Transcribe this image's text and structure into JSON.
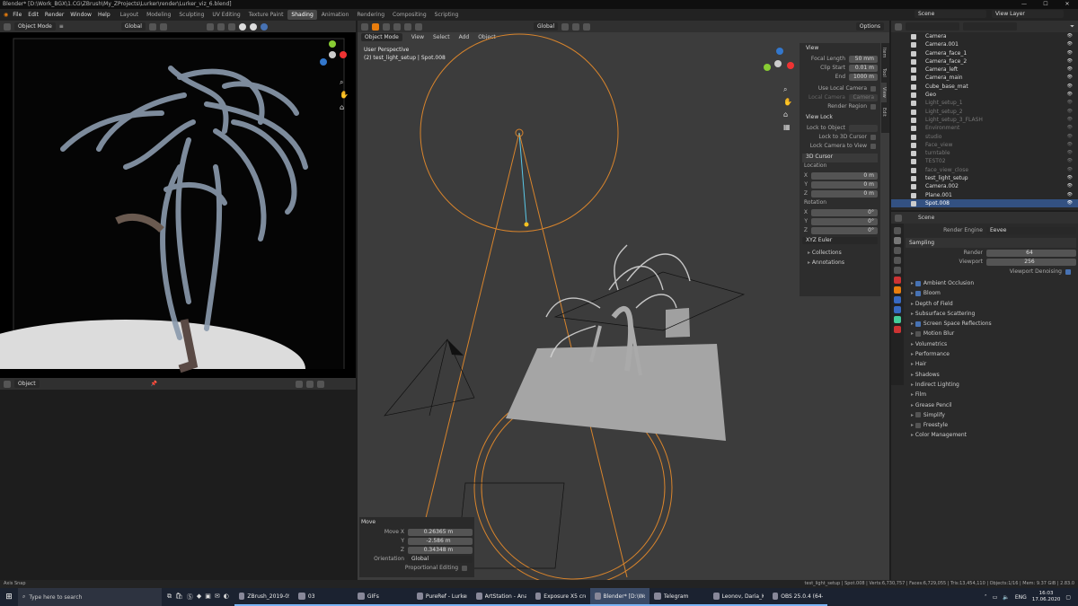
{
  "titlebar": {
    "title": "Blender* [D:\\Work_BGX\\1.CG\\ZBrush\\My_ZProjects\\Lurker\\render\\Lurker_viz_6.blend]"
  },
  "menubar": {
    "menus": [
      "File",
      "Edit",
      "Render",
      "Window",
      "Help"
    ],
    "workspaces": [
      "Layout",
      "Modeling",
      "Sculpting",
      "UV Editing",
      "Texture Paint",
      "Shading",
      "Animation",
      "Rendering",
      "Compositing",
      "Scripting"
    ],
    "active_workspace": "Shading",
    "scene": "Scene",
    "view_layer": "View Layer"
  },
  "left_viewport": {
    "mode": "Object Mode",
    "orientation": "Global"
  },
  "shader_editor": {
    "mode": "Object"
  },
  "main_viewport": {
    "mode": "Object Mode",
    "menus": [
      "View",
      "Select",
      "Add",
      "Object"
    ],
    "orientation": "Global",
    "options": "Options",
    "overlay_title": "User Perspective",
    "overlay_sub": "(2) test_light_setup | Spot.008"
  },
  "npanel": {
    "tabs": [
      "Item",
      "Tool",
      "View",
      "Edit"
    ],
    "view_header": "View",
    "focal_length_label": "Focal Length",
    "focal_length": "50 mm",
    "clip_start_label": "Clip Start",
    "clip_start": "0.01 m",
    "end_label": "End",
    "end": "1000 m",
    "use_local_camera": "Use Local Camera",
    "local_camera": "Local Camera",
    "local_camera_val": "Camera",
    "render_region": "Render Region",
    "view_lock": "View Lock",
    "lock_to_object": "Lock to Object",
    "lock_to_3d_cursor": "Lock to 3D Cursor",
    "lock_camera_to_view": "Lock Camera to View",
    "cursor_header": "3D Cursor",
    "location": "Location",
    "x": "X",
    "y": "Y",
    "z": "Z",
    "loc_x": "0 m",
    "loc_y": "0 m",
    "loc_z": "0 m",
    "rotation": "Rotation",
    "rot_x": "0°",
    "rot_y": "0°",
    "rot_z": "0°",
    "rot_mode": "XYZ Euler",
    "collections": "Collections",
    "annotations": "Annotations"
  },
  "move_panel": {
    "title": "Move",
    "move_x_label": "Move X",
    "move_x": "0.26365 m",
    "y_label": "Y",
    "y": "-2.586 m",
    "z_label": "Z",
    "z": "0.34348 m",
    "orientation_label": "Orientation",
    "orientation": "Global",
    "proportional": "Proportional Editing"
  },
  "outliner": {
    "items": [
      {
        "name": "Camera",
        "dim": false,
        "sel": false
      },
      {
        "name": "Camera.001",
        "dim": false,
        "sel": false
      },
      {
        "name": "Camera_face_1",
        "dim": false,
        "sel": false
      },
      {
        "name": "Camera_face_2",
        "dim": false,
        "sel": false
      },
      {
        "name": "Camera_left",
        "dim": false,
        "sel": false
      },
      {
        "name": "Camera_main",
        "dim": false,
        "sel": false
      },
      {
        "name": "Cube_base_mat",
        "dim": false,
        "sel": false
      },
      {
        "name": "Geo",
        "dim": false,
        "sel": false
      },
      {
        "name": "Light_setup_1",
        "dim": true,
        "sel": false
      },
      {
        "name": "Light_setup_2",
        "dim": true,
        "sel": false
      },
      {
        "name": "Light_setup_3_FLASH",
        "dim": true,
        "sel": false
      },
      {
        "name": "Environment",
        "dim": true,
        "sel": false
      },
      {
        "name": "studio",
        "dim": true,
        "sel": false
      },
      {
        "name": "Face_view",
        "dim": true,
        "sel": false
      },
      {
        "name": "turntable",
        "dim": true,
        "sel": false
      },
      {
        "name": "TEST02",
        "dim": true,
        "sel": false
      },
      {
        "name": "face_view_close",
        "dim": true,
        "sel": false
      },
      {
        "name": "test_light_setup",
        "dim": false,
        "sel": false
      },
      {
        "name": "Camera.002",
        "dim": false,
        "sel": false
      },
      {
        "name": "Plane.001",
        "dim": false,
        "sel": false
      },
      {
        "name": "Spot.008",
        "dim": false,
        "sel": true
      }
    ]
  },
  "properties": {
    "scene": "Scene",
    "render_engine_label": "Render Engine",
    "render_engine": "Eevee",
    "sampling": "Sampling",
    "render_label": "Render",
    "render": "64",
    "viewport_label": "Viewport",
    "viewport": "256",
    "viewport_denoising": "Viewport Denoising",
    "sections": [
      {
        "name": "Ambient Occlusion",
        "check": true
      },
      {
        "name": "Bloom",
        "check": true
      },
      {
        "name": "Depth of Field",
        "check": null
      },
      {
        "name": "Subsurface Scattering",
        "check": null
      },
      {
        "name": "Screen Space Reflections",
        "check": true
      },
      {
        "name": "Motion Blur",
        "check": false
      },
      {
        "name": "Volumetrics",
        "check": null
      },
      {
        "name": "Performance",
        "check": null
      },
      {
        "name": "Hair",
        "check": null
      },
      {
        "name": "Shadows",
        "check": null
      },
      {
        "name": "Indirect Lighting",
        "check": null
      },
      {
        "name": "Film",
        "check": null
      },
      {
        "name": "Grease Pencil",
        "check": null
      },
      {
        "name": "Simplify",
        "check": false
      },
      {
        "name": "Freestyle",
        "check": false
      },
      {
        "name": "Color Management",
        "check": null
      }
    ]
  },
  "statusbar": {
    "left": "Axis Snap",
    "right": "test_light_setup | Spot.008 | Verts:6,730,757 | Faces:6,729,055 | Tris:13,454,110 | Objects:1/16 | Mem: 9.37 GiB | 2.83.0"
  },
  "taskbar": {
    "search": "Type here to search",
    "tasks": [
      {
        "label": "ZBrush_2019-05-...",
        "open": true,
        "active": false
      },
      {
        "label": "03",
        "open": true,
        "active": false
      },
      {
        "label": "GIFs",
        "open": true,
        "active": false
      },
      {
        "label": "PureRef - Lurker...",
        "open": true,
        "active": false
      },
      {
        "label": "ArtStation - Anal...",
        "open": true,
        "active": false
      },
      {
        "label": "Exposure X5 crea...",
        "open": true,
        "active": false
      },
      {
        "label": "Blender* [D:\\Wor...",
        "open": true,
        "active": true
      },
      {
        "label": "Telegram",
        "open": true,
        "active": false
      },
      {
        "label": "Leonov, Daria_Kr...",
        "open": true,
        "active": false
      },
      {
        "label": "OBS 25.0.4 (64-bi...",
        "open": true,
        "active": false
      }
    ],
    "lang": "ENG",
    "time": "16:03",
    "date": "17.06.2020"
  }
}
